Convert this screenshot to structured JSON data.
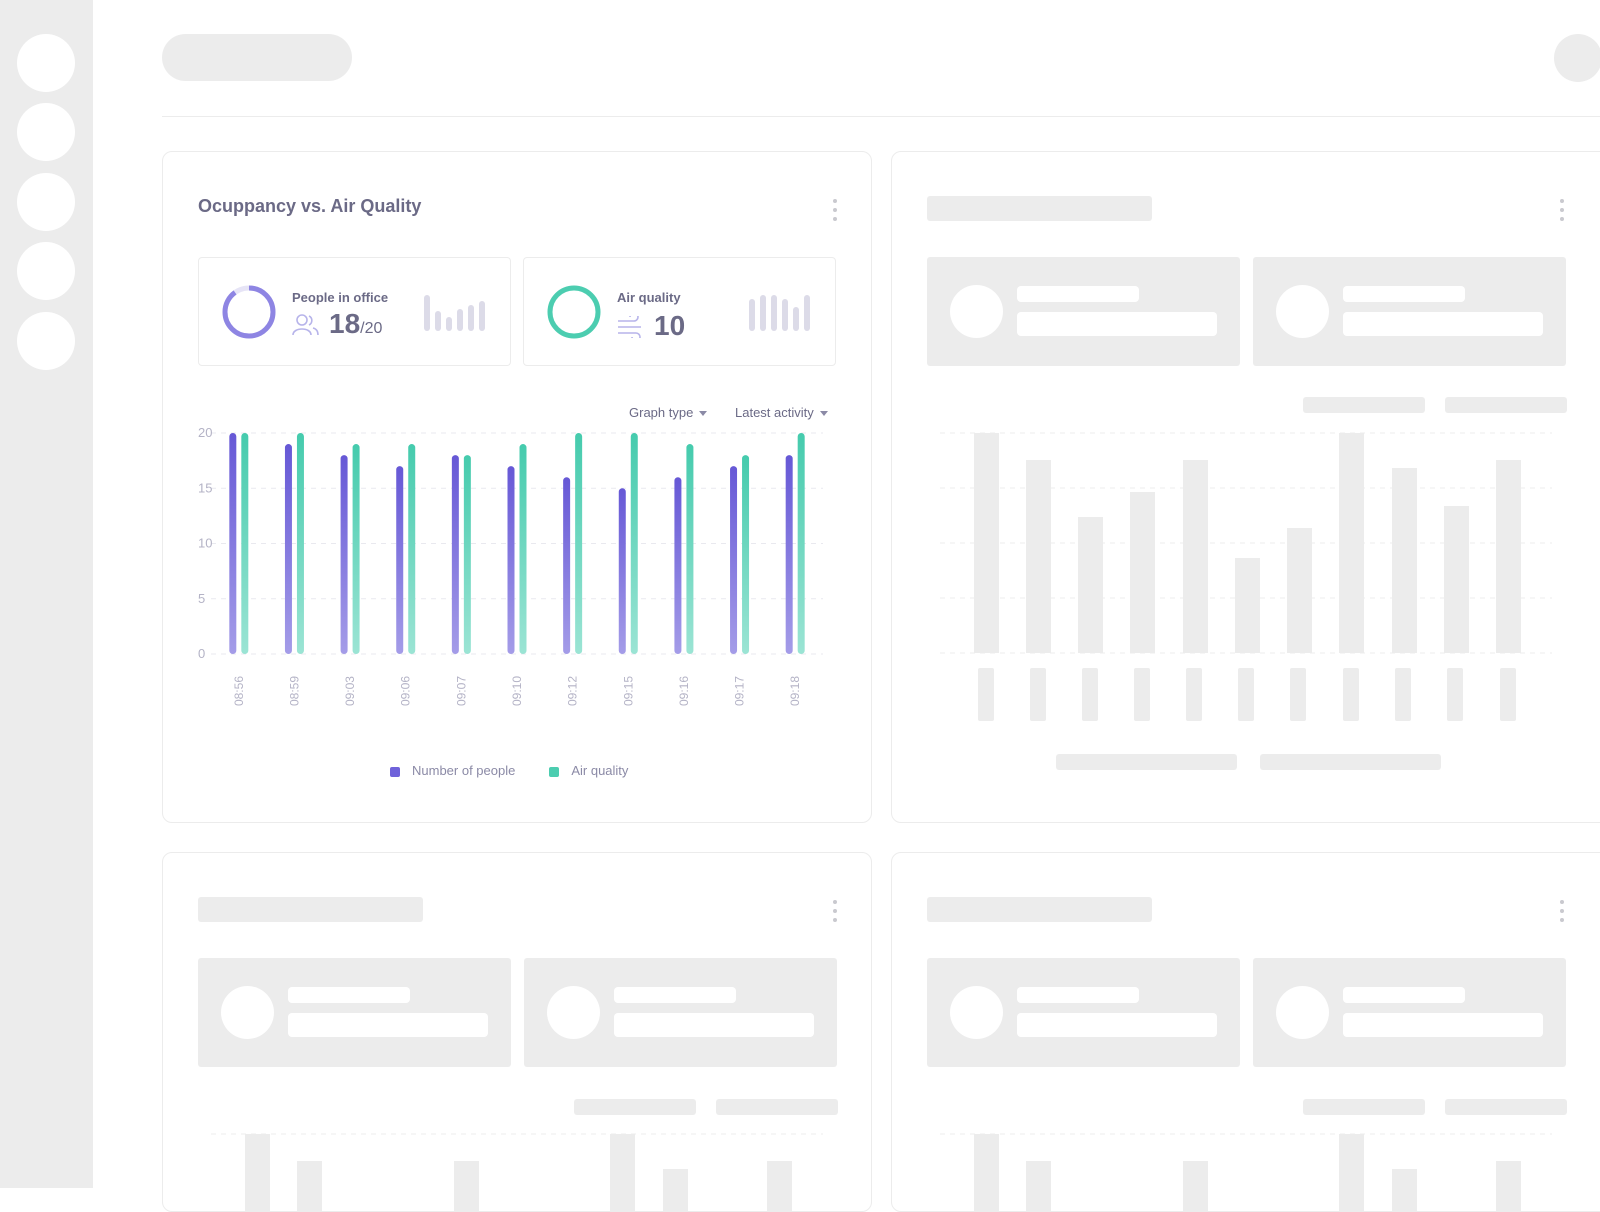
{
  "card": {
    "title": "Ocuppancy vs. Air Quality",
    "kpis": {
      "people": {
        "label": "People in office",
        "value": "18",
        "total": "/20",
        "icon": "people-icon"
      },
      "air": {
        "label": "Air quality",
        "value": "10",
        "icon": "wind-icon"
      }
    },
    "controls": {
      "graph_type": "Graph type",
      "range": "Latest activity"
    }
  },
  "colors": {
    "purple": "#6f62da",
    "teal": "#4ccdb0",
    "text": "#6b6a86",
    "skeleton": "#ececec"
  },
  "chart_data": {
    "type": "bar",
    "categories": [
      "08:56",
      "08:59",
      "09:03",
      "09:06",
      "09:07",
      "09:10",
      "09:12",
      "09:15",
      "09:16",
      "09:17",
      "09:18"
    ],
    "series": [
      {
        "name": "Number of people",
        "values": [
          20,
          19,
          18,
          17,
          18,
          17,
          16,
          15,
          16,
          17,
          18
        ]
      },
      {
        "name": "Air quality",
        "values": [
          20,
          20,
          19,
          19,
          18,
          19,
          20,
          20,
          19,
          18,
          20
        ]
      }
    ],
    "yticks": [
      "0",
      "5",
      "10",
      "15",
      "20"
    ],
    "ylim": [
      0,
      20
    ],
    "grid": true,
    "legend": "bottom"
  }
}
